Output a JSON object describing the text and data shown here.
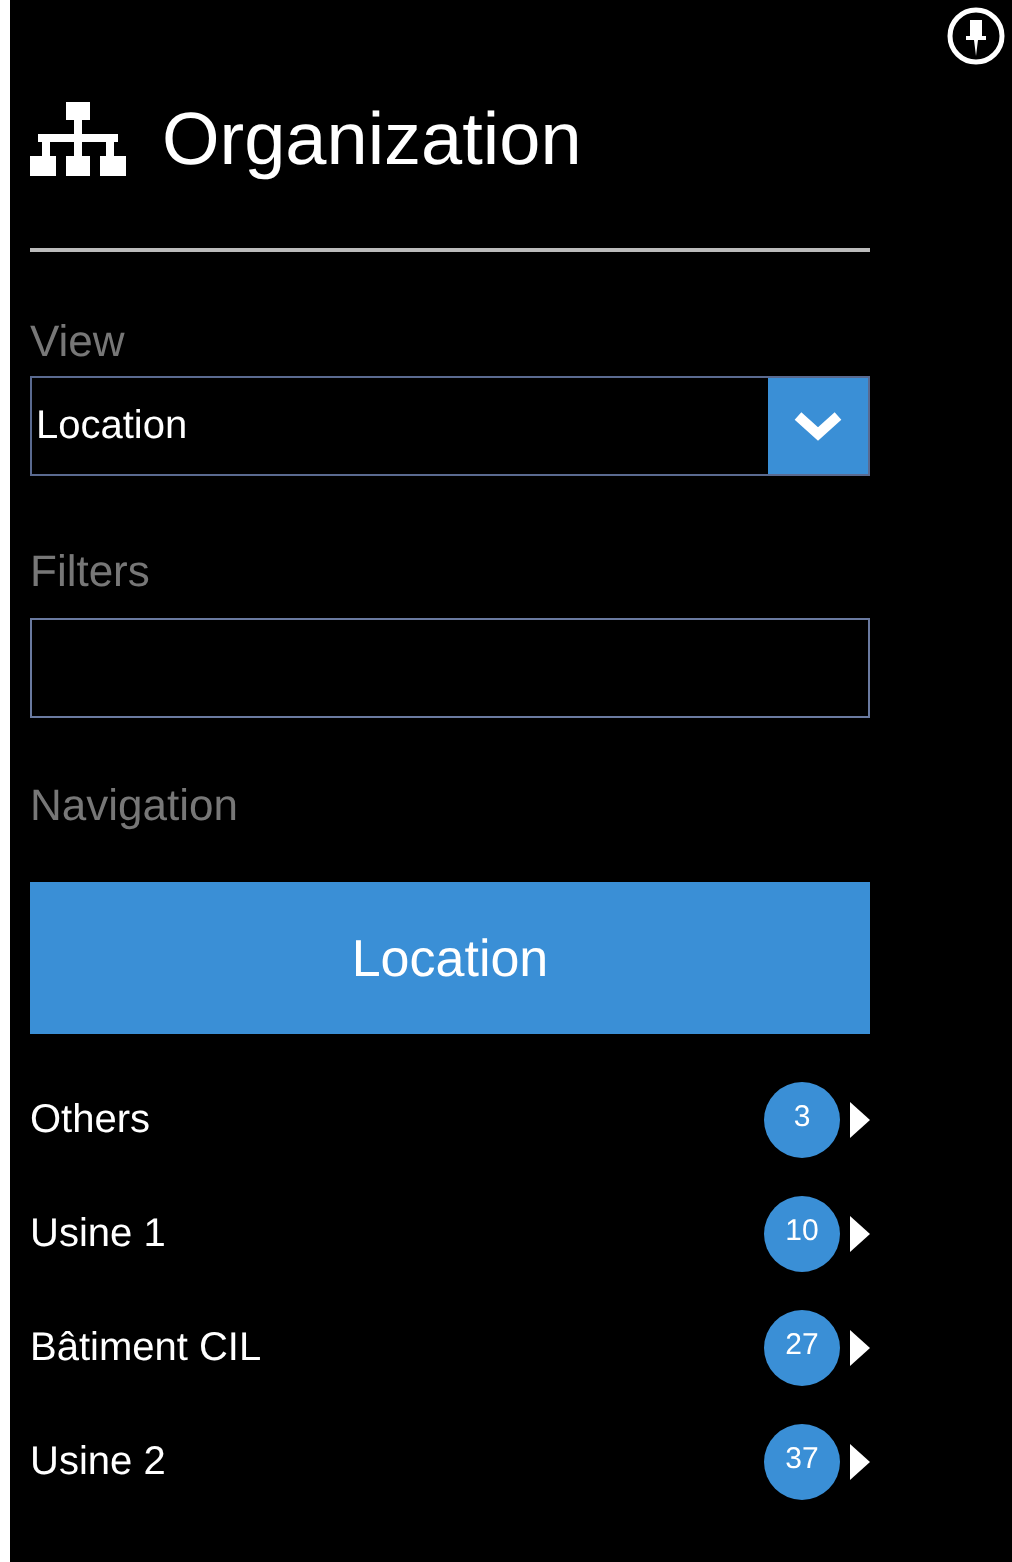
{
  "header": {
    "title": "Organization"
  },
  "view": {
    "label": "View",
    "value": "Location"
  },
  "filters": {
    "label": "Filters"
  },
  "navigation": {
    "label": "Navigation",
    "button": "Location",
    "items": [
      {
        "label": "Others",
        "count": "3"
      },
      {
        "label": "Usine 1",
        "count": "10"
      },
      {
        "label": "Bâtiment CIL",
        "count": "27"
      },
      {
        "label": "Usine 2",
        "count": "37"
      }
    ]
  }
}
